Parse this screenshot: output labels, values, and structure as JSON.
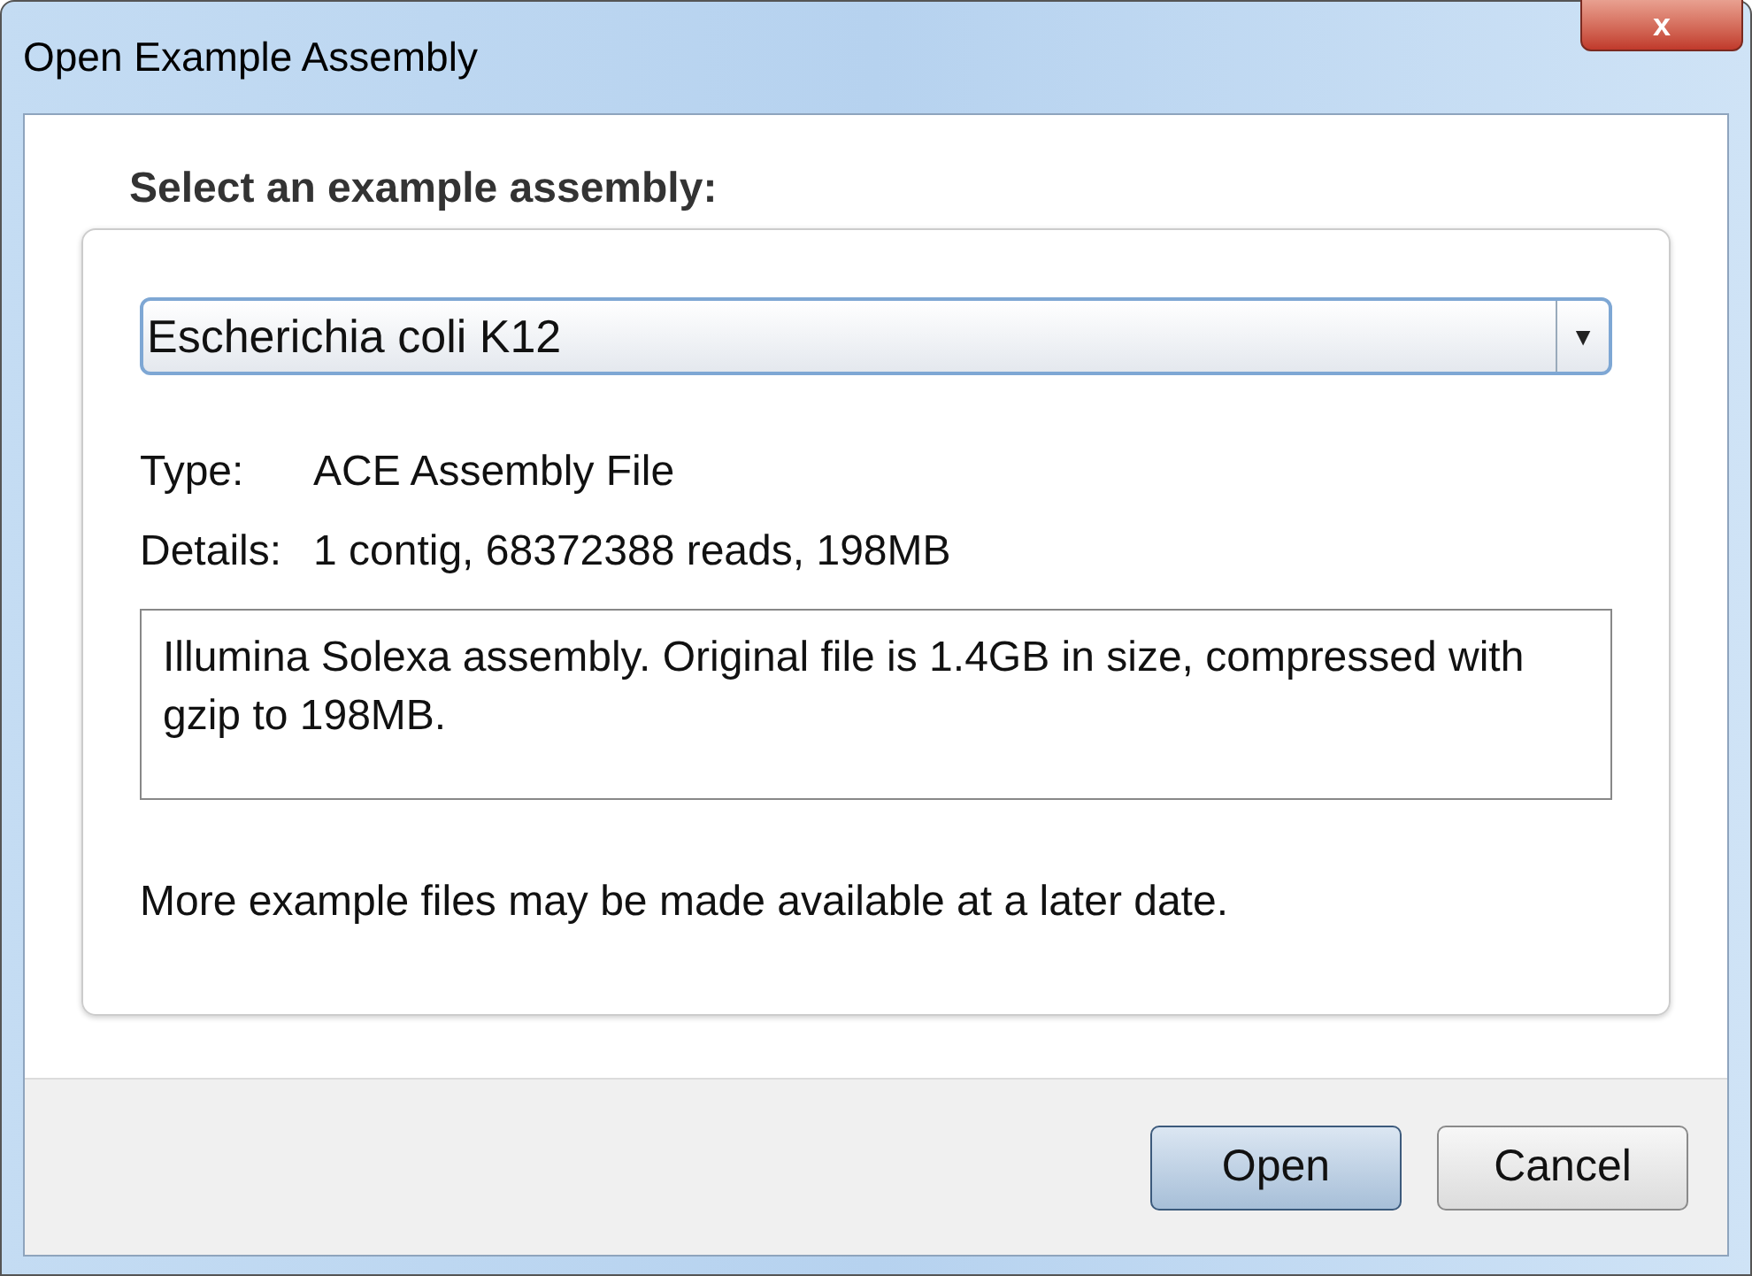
{
  "window": {
    "title": "Open Example Assembly",
    "close": "x"
  },
  "heading": "Select an example assembly:",
  "dropdown": {
    "value": "Escherichia coli K12",
    "arrow": "▼"
  },
  "info": [
    {
      "label": "Type:",
      "value": "ACE Assembly File"
    },
    {
      "label": "Details:",
      "value": "1 contig, 68372388 reads, 198MB"
    }
  ],
  "description": "Illumina Solexa assembly. Original file is 1.4GB in size, compressed with gzip to 198MB.",
  "note": "More example files may be made available at a later date.",
  "buttons": [
    {
      "label": "Open",
      "default": true
    },
    {
      "label": "Cancel",
      "default": false
    }
  ]
}
